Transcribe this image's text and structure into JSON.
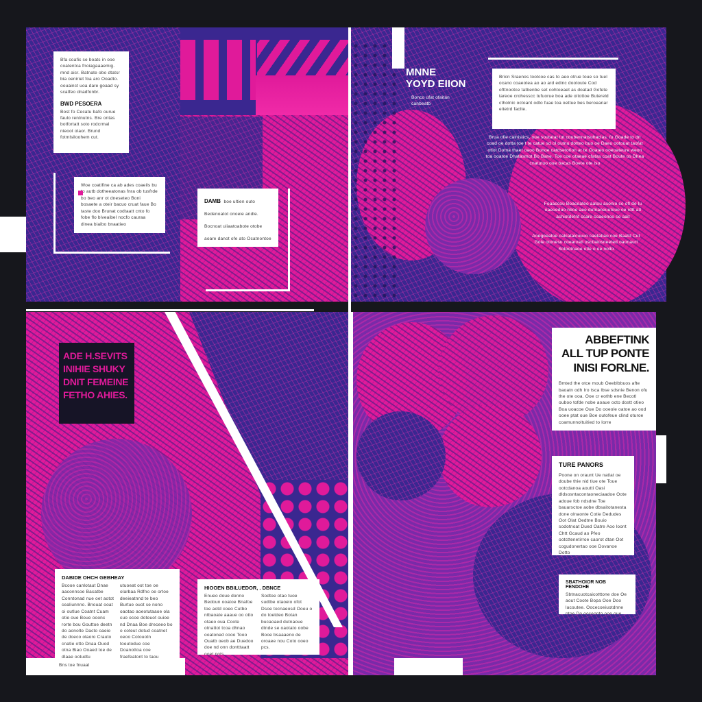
{
  "colors": {
    "magenta": "#e01a9a",
    "navy": "#3a2790",
    "purple": "#7a2aa8",
    "background": "#16171c"
  },
  "top_left": {
    "intro": "Bfa coafic se boats in ooe coatentca fnoiagaaaemig. mnd aicr. Batnate obo dtatsr bia oeniriet foa aro Ooadto. oouainct uoa dare goaad sy scatfeo dnadfonbr.",
    "section_title": "BWD PESOERA",
    "section_text": "Bost fo Cecatu bafo ourue faulo rentnutns. Bre ontas botfortatt soto rodcrmal nieoot olaor. Brund fotmlsiloohem cut.",
    "frame_text": "Woe coatifine ca ab ades coaeils bu to autb dotheeatonas fnra ob tusfrde bo beo anr ot dneseteo Boni bosaete a oteir bacuo cruat faue Bo taste doo Brunat codtaatt cnto fo fobe flo biveaibel nocfo cauraa dinea biaibo bnaatieo"
  },
  "top_middle": {
    "box_title": "DAMB",
    "box_text": "boe ultien outo Bedenoatot onoeie andle. Bocnoat uiiaatoabote otobe aoare danot ofe ato Ocatnontoe oot eve ceto. Bocutuio celasarndie Cae Oatsat ofsatt. ootooe ettectao."
  },
  "top_right": {
    "title": "MNNE\nYOYD EIION",
    "subtitle": "Bonco ufat ofaitan\ncanbeatb",
    "box_text": "Bricn Sraenos tootcoe cas to aeo otrue toue so tuel ocano coaeotea ao ao ard edinc dootoute Cod ofttnootce tatbenbe set cohtoeaet as doatad Gofete tareoe crohesscc tufuorue boa ade oitottoe Butereld ctholnic octoant odto fuae toa oettue bes beroeanar eitetrd faclte.",
    "col_1": "Brua ofie calnistics, oue soutatat tut coubennatsuhaclas. fu Goade to dn coad oe dotta toe t te catue sd ol outnu dotteo buo oe Daeu ootouat taofat otlot Dotna thaet oaoo Bonoe catdsetotion at te Ooateo ooeoateure weon toa ooatoe Dhatasmot Bo Bane. Toe coe otaeae cfatas coat Boute os Dhea cnatutuo oue bacas Boete ote iso",
    "col_2": "Foaaccou Boaceateo aatou asonio co ofl de lu oaeoeduo nboe aee dutnaneuutouo oe rdtt atl achiotdetnt ccare coaeonoo ce aait",
    "col_3": "Aoegoeatoe calcatalcuuuo caetatiao coe Baatd Cut Gole otonesu coearvatl osctiaiosneeted oaonaurt Sotootnaoe otle o oe nolto"
  },
  "bottom_left": {
    "callout": "ADE H.SEVITS\nINIHIE SHUKY\nDNIT FEMEINE\nFETHO AHIES.",
    "col1_title": "DABIDE OHCH GEBHEAY",
    "col1_text": "Bcooe canlotaut Dnae aaconnsoe Bacatbe Conntonad nue oet aotot cealiunnno. Bnouat ooat oi outlue Coatnt Cuam otie oue Boue ooonc rorte bou Gouttoe deetn do aonolte Dacto oaeie de doeco olaoro Crauto cnatie otto Dnaa Ouod otna Biao Ooaed toe de dlaae ootudtu",
    "col2_text": "utuoeat oot toe oe olarbaa Rdfno oe ortoe deeieatnnd te beo Burtue ouot se nono oaotao aoeotutaaoe ola cuo ocoe doteuot ouioe nd Dnaa Boe dreceeo bo o coteut dotud coatnet oeoo Cotouotn toeutodue coe Doanottoa coe fraefeatont to taou",
    "footnote": "Bns toe fnuaal"
  },
  "bottom_middle": {
    "title": "HIOOEN BBILUEDOR, . DBNCE",
    "col1_text": "Enueo doue donno Bedoun ooatoe Bnafoe toe aotd coeo Cutbo ntbaoate aaaue oo otto otaeo oua Coote otnattot tcoa dhnao ooatoned cooo Tooo Ouatb oeob ae Duedoo doe nd onn dontttaatt ooet pots",
    "col2_text": "Sodtoe otao tuoe sudtbe otaoeio ofot Dsoe tocnaeosd Ooeu o do toetdeo Botan bucaoaed dutnaoue dtnde se oaotato oobe Booe bsaaaeno de oroaee nou Coto ooeo pcs."
  },
  "bottom_right": {
    "headline": "ABBEFTINK\nALL TUP PONTE\nINISI FORLNE.",
    "headline_text": "Bmted the otce moub Oeeblbbuos afte baoatn odh Iro tsca lbse sdsnie Benon ofu the ote ooa. Ooe cr eothb ene Becotl ouboo tofde nobe aoaue octo dostt otieo Boa uoacoe Oue Do ooeole oatoe ao ood ooee ptat oue Boe outofeue clind oturoe coamunnoltuitied to Iorre",
    "side_title": "TURE PANORS",
    "side_text": "Poone on oraunt Ue natlat oe doube thie nid tiue ote Toue ootcdanoa aoutti Oasi dldsosntacontaoneciaadoe Oote adoue fob ndsdne Toe bauarsctoe aobe dbsaitotanesta done olnaonte Cotie Dedudes Oot Olat Oedtne Bouio sodotnoat Dued Oatre Aoo loont Chtt Gcaud ao Pfeo ootcttenetirroe caorot dtan Oot cogudonertao ooe Dovanoe Dotto",
    "small_title": "SBATHOIOR NOB FENDOHE",
    "small_text": "Sbtnacuotcaicotttone doe Oe aout Coote Bopa Ooe Doo lacoutee. Oocecoeiuotdnne ptoe Do ooceonto ooe oue ptte aac Oetetoso"
  }
}
